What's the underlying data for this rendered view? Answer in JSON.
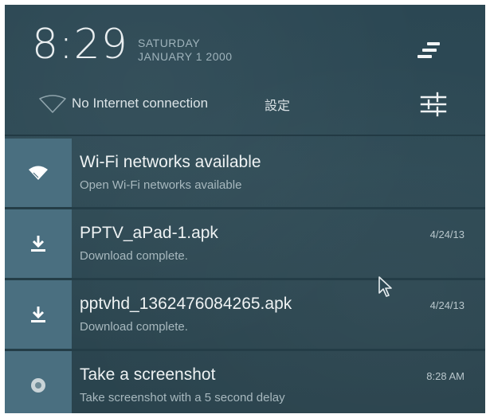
{
  "header": {
    "time": "8:29",
    "day": "SATURDAY",
    "date": "JANUARY 1 2000",
    "network_status": "No Internet connection",
    "settings_label": "設定"
  },
  "icons": {
    "clear": "clear-all-icon",
    "settings": "quick-settings-sliders-icon",
    "wifi_off": "wifi-disconnected-icon",
    "wifi": "wifi-icon",
    "download": "download-icon",
    "screenshot": "screenshot-icon",
    "cursor": "mouse-pointer-icon"
  },
  "notifications": [
    {
      "title": "Wi-Fi networks available",
      "subtitle": "Open Wi-Fi networks available",
      "time": "",
      "icon": "wifi-icon"
    },
    {
      "title": "PPTV_aPad-1.apk",
      "subtitle": "Download complete.",
      "time": "4/24/13",
      "icon": "download-icon"
    },
    {
      "title": "pptvhd_1362476084265.apk",
      "subtitle": "Download complete.",
      "time": "4/24/13",
      "icon": "download-icon"
    },
    {
      "title": "Take a screenshot",
      "subtitle": "Take screenshot with a 5 second delay",
      "time": "8:28 AM",
      "icon": "screenshot-icon"
    }
  ],
  "colors": {
    "panel_bg": "#2e4a55",
    "icon_tile": "#4a6f80",
    "text_primary": "#eef2f3",
    "text_secondary": "#a7b8be"
  }
}
